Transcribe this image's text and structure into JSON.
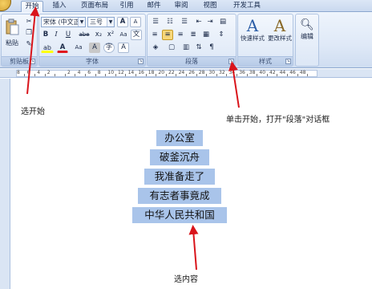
{
  "tabs": [
    "开始",
    "插入",
    "页面布局",
    "引用",
    "邮件",
    "审阅",
    "视图",
    "开发工具"
  ],
  "clipboard": {
    "paste_label": "粘贴",
    "group_label": "剪贴板"
  },
  "font": {
    "font_name": "宋体 (中文正)",
    "font_size": "三号",
    "grow_label": "A",
    "shrink_label": "A",
    "bold": "B",
    "italic": "I",
    "underline": "U",
    "strike": "abe",
    "subscript": "x₂",
    "superscript": "x²",
    "clear_format": "Aa",
    "wen": "文",
    "highlight": "ab",
    "color_a": "A",
    "change_case": "Aa",
    "char_border": "A",
    "enclose": "字",
    "char_shade": "A",
    "phonetic": "wén",
    "group_label": "字体"
  },
  "paragraph": {
    "group_label": "段落"
  },
  "styles": {
    "quick_label": "快速样式",
    "change_label": "更改样式",
    "group_label": "样式"
  },
  "editing": {
    "label": "编辑"
  },
  "ruler_numbers": [
    "8",
    "6",
    "4",
    "2",
    "",
    "2",
    "4",
    "6",
    "8",
    "10",
    "12",
    "14",
    "16",
    "18",
    "20",
    "22",
    "24",
    "26",
    "28",
    "30",
    "32",
    "34",
    "36",
    "38",
    "40",
    "42",
    "44",
    "46",
    "48"
  ],
  "document_lines": [
    "办公室",
    "破釜沉舟",
    "我准备走了",
    "有志者事竟成",
    "中华人民共和国"
  ],
  "annotations": {
    "select_start": "选开始",
    "open_paragraph": "单击开始，打开\"段落\"对话框",
    "select_content": "选内容"
  },
  "colors": {
    "annotation_arrow": "#d9141b",
    "selection": "#a9c4ea",
    "font_color_red": "#e0161d",
    "highlight_yellow": "#ffff00"
  }
}
